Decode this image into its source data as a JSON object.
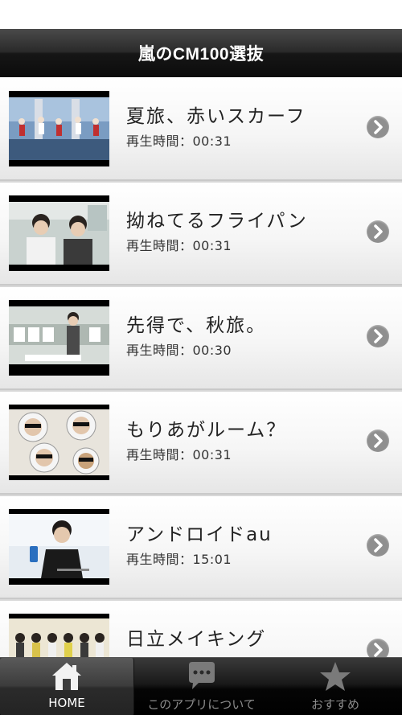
{
  "header": {
    "title": "嵐のCM100選抜"
  },
  "videos": [
    {
      "title": "夏旅、赤いスカーフ",
      "duration": "再生時間：00:31",
      "thumbnail": "jal-summer-travel-thumbnail"
    },
    {
      "title": "拗ねてるフライパン",
      "duration": "再生時間：00:31",
      "thumbnail": "frying-pan-cm-thumbnail"
    },
    {
      "title": "先得で、秋旅。",
      "duration": "再生時間：00:30",
      "thumbnail": "autumn-travel-thumbnail"
    },
    {
      "title": "もりあがルーム？",
      "duration": "再生時間：00:31",
      "thumbnail": "morigaru-room-thumbnail"
    },
    {
      "title": "アンドロイドau",
      "duration": "再生時間：15:01",
      "thumbnail": "android-au-thumbnail"
    },
    {
      "title": "日立メイキング",
      "duration": "",
      "thumbnail": "hitachi-making-thumbnail"
    }
  ],
  "tabs": [
    {
      "label": "HOME",
      "icon": "home-icon",
      "active": true
    },
    {
      "label": "このアプリについて",
      "icon": "speech-bubble-icon",
      "active": false
    },
    {
      "label": "おすすめ",
      "icon": "star-icon",
      "active": false
    }
  ],
  "colors": {
    "accent": "#8f8f8f",
    "bar": "#1a1a1a",
    "active_tab_label": "#ffffff",
    "inactive_tab_label": "#8c8c8c"
  }
}
